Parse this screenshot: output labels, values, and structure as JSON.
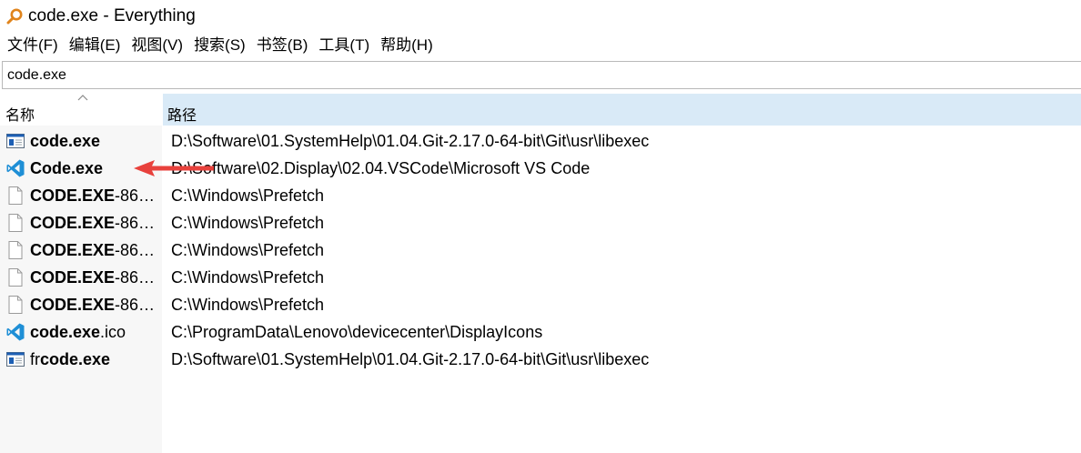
{
  "window": {
    "title": "code.exe - Everything",
    "app_icon": "magnifier-icon"
  },
  "menu": [
    {
      "label": "文件(F)"
    },
    {
      "label": "编辑(E)"
    },
    {
      "label": "视图(V)"
    },
    {
      "label": "搜索(S)"
    },
    {
      "label": "书签(B)"
    },
    {
      "label": "工具(T)"
    },
    {
      "label": "帮助(H)"
    }
  ],
  "search": {
    "value": "code.exe"
  },
  "columns": {
    "name": "名称",
    "path": "路径",
    "sort_indicator": "^"
  },
  "rows": [
    {
      "icon": "exe-window-icon",
      "name_bold": "code.exe",
      "name_rest": "",
      "path": "D:\\Software\\01.SystemHelp\\01.04.Git-2.17.0-64-bit\\Git\\usr\\libexec"
    },
    {
      "icon": "vscode-icon",
      "name_bold": "Code.exe",
      "name_rest": "",
      "path": "D:\\Software\\02.Display\\02.04.VSCode\\Microsoft VS Code"
    },
    {
      "icon": "file-icon",
      "name_bold": "CODE.EXE",
      "name_rest": "-86…",
      "path": "C:\\Windows\\Prefetch"
    },
    {
      "icon": "file-icon",
      "name_bold": "CODE.EXE",
      "name_rest": "-86…",
      "path": "C:\\Windows\\Prefetch"
    },
    {
      "icon": "file-icon",
      "name_bold": "CODE.EXE",
      "name_rest": "-86…",
      "path": "C:\\Windows\\Prefetch"
    },
    {
      "icon": "file-icon",
      "name_bold": "CODE.EXE",
      "name_rest": "-86…",
      "path": "C:\\Windows\\Prefetch"
    },
    {
      "icon": "file-icon",
      "name_bold": "CODE.EXE",
      "name_rest": "-86…",
      "path": "C:\\Windows\\Prefetch"
    },
    {
      "icon": "vscode-icon",
      "name_bold": "code.exe",
      "name_rest": ".ico",
      "path": "C:\\ProgramData\\Lenovo\\devicecenter\\DisplayIcons"
    },
    {
      "icon": "exe-window-icon",
      "name_pre": "fr",
      "name_bold": "code.exe",
      "name_rest": "",
      "path": "D:\\Software\\01.SystemHelp\\01.04.Git-2.17.0-64-bit\\Git\\usr\\libexec"
    }
  ],
  "annotation": {
    "arrow_color": "#e8413c",
    "points_to_row": 2
  },
  "colors": {
    "path_header_bg": "#d9eaf7",
    "name_column_bg": "#f7f7f7",
    "vscode_blue": "#1f8fd6",
    "exe_blue": "#1d5fb4"
  }
}
